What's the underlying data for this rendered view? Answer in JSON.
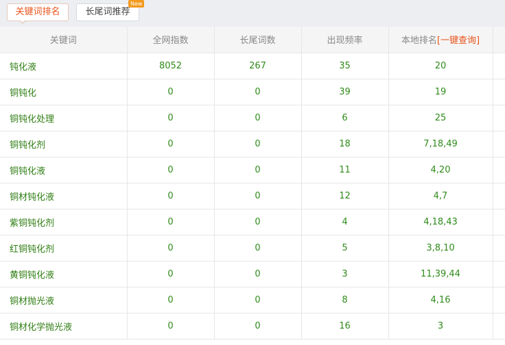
{
  "tabs": {
    "keyword_rank": "关键词排名",
    "longtail_recommend": "长尾词推荐",
    "new_badge": "New"
  },
  "table": {
    "headers": {
      "keyword": "关键词",
      "network_index": "全网指数",
      "longtail_count": "长尾词数",
      "frequency": "出现频率",
      "local_rank": "本地排名",
      "query_link": "[一键查询]"
    },
    "rows": [
      {
        "keyword": "钝化液",
        "network_index": "8052",
        "longtail_count": "267",
        "frequency": "35",
        "local_rank": "20"
      },
      {
        "keyword": "铜钝化",
        "network_index": "0",
        "longtail_count": "0",
        "frequency": "39",
        "local_rank": "19"
      },
      {
        "keyword": "铜钝化处理",
        "network_index": "0",
        "longtail_count": "0",
        "frequency": "6",
        "local_rank": "25"
      },
      {
        "keyword": "铜钝化剂",
        "network_index": "0",
        "longtail_count": "0",
        "frequency": "18",
        "local_rank": "7,18,49"
      },
      {
        "keyword": "铜钝化液",
        "network_index": "0",
        "longtail_count": "0",
        "frequency": "11",
        "local_rank": "4,20"
      },
      {
        "keyword": "铜材钝化液",
        "network_index": "0",
        "longtail_count": "0",
        "frequency": "12",
        "local_rank": "4,7"
      },
      {
        "keyword": "紫铜钝化剂",
        "network_index": "0",
        "longtail_count": "0",
        "frequency": "4",
        "local_rank": "4,18,43"
      },
      {
        "keyword": "红铜钝化剂",
        "network_index": "0",
        "longtail_count": "0",
        "frequency": "5",
        "local_rank": "3,8,10"
      },
      {
        "keyword": "黄铜钝化液",
        "network_index": "0",
        "longtail_count": "0",
        "frequency": "3",
        "local_rank": "11,39,44"
      },
      {
        "keyword": "铜材抛光液",
        "network_index": "0",
        "longtail_count": "0",
        "frequency": "8",
        "local_rank": "4,16"
      },
      {
        "keyword": "铜材化学抛光液",
        "network_index": "0",
        "longtail_count": "0",
        "frequency": "16",
        "local_rank": "3"
      }
    ]
  },
  "colors": {
    "accent": "#e8541a",
    "keyword_green": "#2e7d12",
    "value_green": "#2e8b1a",
    "header_bg": "#f5f5f5",
    "tabbar_bg": "#eceef2",
    "badge": "#f39a1c"
  }
}
